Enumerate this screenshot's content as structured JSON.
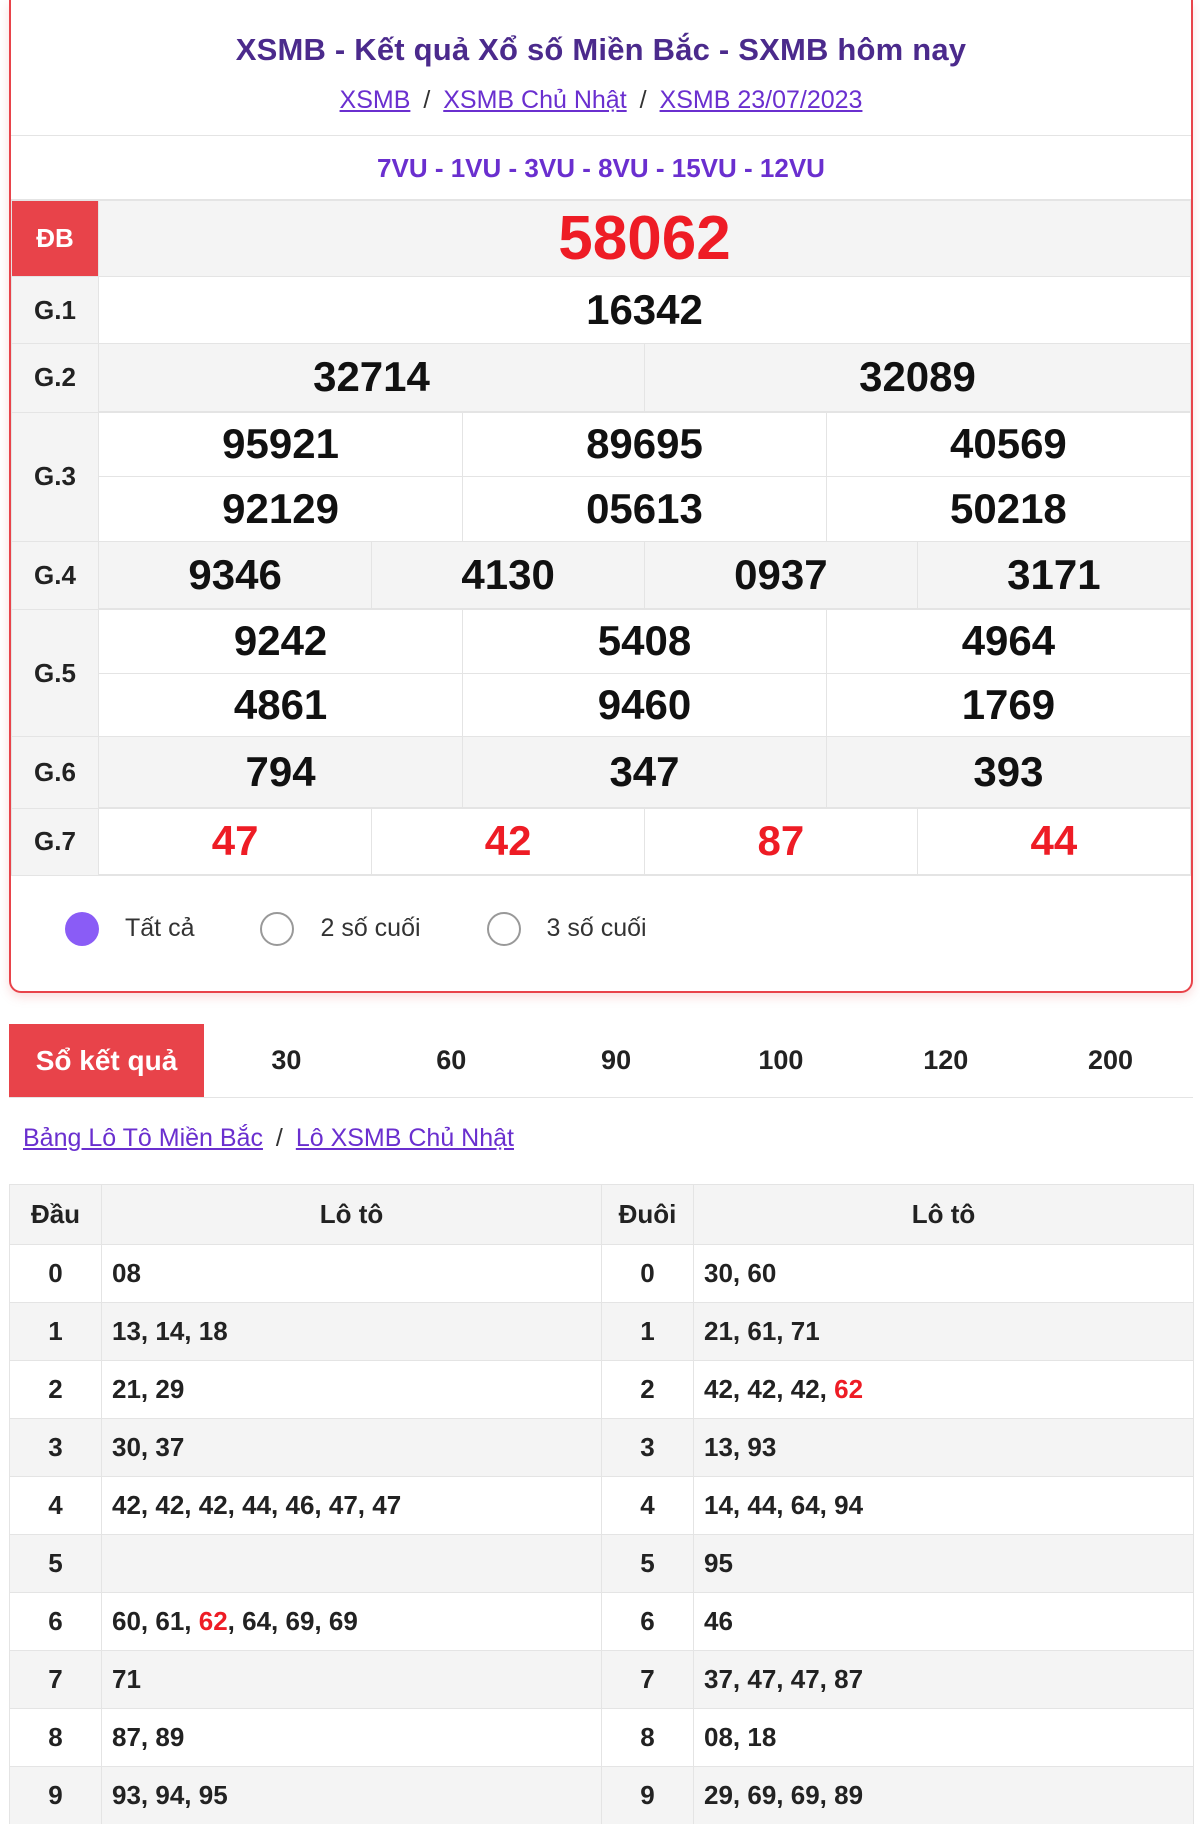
{
  "header": {
    "title": "XSMB - Kết quả Xổ số Miền Bắc - SXMB hôm nay",
    "breadcrumb": [
      {
        "label": "XSMB"
      },
      {
        "label": "XSMB Chủ Nhật"
      },
      {
        "label": "XSMB 23/07/2023"
      }
    ],
    "separator": "/"
  },
  "codes": "7VU - 1VU - 3VU - 8VU - 15VU - 12VU",
  "results": {
    "db": {
      "label": "ĐB",
      "numbers": [
        "58062"
      ]
    },
    "g1": {
      "label": "G.1",
      "numbers": [
        "16342"
      ]
    },
    "g2": {
      "label": "G.2",
      "numbers": [
        "32714",
        "32089"
      ]
    },
    "g3": {
      "label": "G.3",
      "numbers": [
        "95921",
        "89695",
        "40569",
        "92129",
        "05613",
        "50218"
      ]
    },
    "g4": {
      "label": "G.4",
      "numbers": [
        "9346",
        "4130",
        "0937",
        "3171"
      ]
    },
    "g5": {
      "label": "G.5",
      "numbers": [
        "9242",
        "5408",
        "4964",
        "4861",
        "9460",
        "1769"
      ]
    },
    "g6": {
      "label": "G.6",
      "numbers": [
        "794",
        "347",
        "393"
      ]
    },
    "g7": {
      "label": "G.7",
      "numbers": [
        "47",
        "42",
        "87",
        "44"
      ]
    }
  },
  "filters": [
    {
      "label": "Tất cả",
      "selected": true
    },
    {
      "label": "2 số cuối",
      "selected": false
    },
    {
      "label": "3 số cuối",
      "selected": false
    }
  ],
  "tabs": {
    "main": "Sổ kết quả",
    "items": [
      "30",
      "60",
      "90",
      "100",
      "120",
      "200"
    ]
  },
  "loto_breadcrumb": [
    {
      "label": "Bảng Lô Tô Miền Bắc"
    },
    {
      "label": "Lô XSMB Chủ Nhật"
    }
  ],
  "loto": {
    "headers": {
      "dau": "Đầu",
      "loto": "Lô tô",
      "duoi": "Đuôi"
    },
    "highlight_color": "#ee1c25",
    "rows": [
      {
        "dau": "0",
        "dau_list": [
          {
            "v": "08"
          }
        ],
        "duoi": "0",
        "duoi_list": [
          {
            "v": "30"
          },
          {
            "v": "60"
          }
        ]
      },
      {
        "dau": "1",
        "dau_list": [
          {
            "v": "13"
          },
          {
            "v": "14"
          },
          {
            "v": "18"
          }
        ],
        "duoi": "1",
        "duoi_list": [
          {
            "v": "21"
          },
          {
            "v": "61"
          },
          {
            "v": "71"
          }
        ]
      },
      {
        "dau": "2",
        "dau_list": [
          {
            "v": "21"
          },
          {
            "v": "29"
          }
        ],
        "duoi": "2",
        "duoi_list": [
          {
            "v": "42"
          },
          {
            "v": "42"
          },
          {
            "v": "42"
          },
          {
            "v": "62",
            "hl": true
          }
        ]
      },
      {
        "dau": "3",
        "dau_list": [
          {
            "v": "30"
          },
          {
            "v": "37"
          }
        ],
        "duoi": "3",
        "duoi_list": [
          {
            "v": "13"
          },
          {
            "v": "93"
          }
        ]
      },
      {
        "dau": "4",
        "dau_list": [
          {
            "v": "42"
          },
          {
            "v": "42"
          },
          {
            "v": "42"
          },
          {
            "v": "44"
          },
          {
            "v": "46"
          },
          {
            "v": "47"
          },
          {
            "v": "47"
          }
        ],
        "duoi": "4",
        "duoi_list": [
          {
            "v": "14"
          },
          {
            "v": "44"
          },
          {
            "v": "64"
          },
          {
            "v": "94"
          }
        ]
      },
      {
        "dau": "5",
        "dau_list": [],
        "duoi": "5",
        "duoi_list": [
          {
            "v": "95"
          }
        ]
      },
      {
        "dau": "6",
        "dau_list": [
          {
            "v": "60"
          },
          {
            "v": "61"
          },
          {
            "v": "62",
            "hl": true
          },
          {
            "v": "64"
          },
          {
            "v": "69"
          },
          {
            "v": "69"
          }
        ],
        "duoi": "6",
        "duoi_list": [
          {
            "v": "46"
          }
        ]
      },
      {
        "dau": "7",
        "dau_list": [
          {
            "v": "71"
          }
        ],
        "duoi": "7",
        "duoi_list": [
          {
            "v": "37"
          },
          {
            "v": "47"
          },
          {
            "v": "47"
          },
          {
            "v": "87"
          }
        ]
      },
      {
        "dau": "8",
        "dau_list": [
          {
            "v": "87"
          },
          {
            "v": "89"
          }
        ],
        "duoi": "8",
        "duoi_list": [
          {
            "v": "08"
          },
          {
            "v": "18"
          }
        ]
      },
      {
        "dau": "9",
        "dau_list": [
          {
            "v": "93"
          },
          {
            "v": "94"
          },
          {
            "v": "95"
          }
        ],
        "duoi": "9",
        "duoi_list": [
          {
            "v": "29"
          },
          {
            "v": "69"
          },
          {
            "v": "69"
          },
          {
            "v": "89"
          }
        ]
      }
    ]
  }
}
